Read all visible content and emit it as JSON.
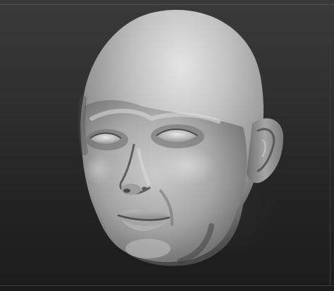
{
  "viewport": {
    "background_top": "#3a3a3a",
    "background_bottom": "#1c1c1c"
  },
  "model": {
    "subject": "sculpted-head-icon",
    "material_base": "#a7a7a7",
    "material_highlight": "#e3e3e3",
    "material_shadow": "#3b3b3b"
  }
}
